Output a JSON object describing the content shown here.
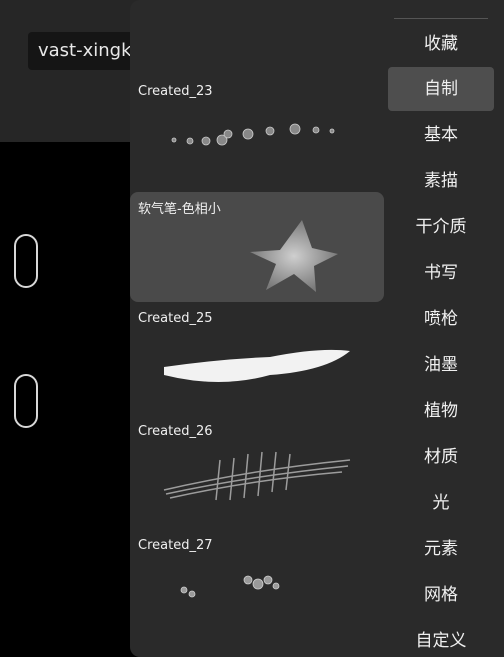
{
  "watermark": "vast-xingkong.com.cn",
  "brushes": [
    {
      "name": "Created_23"
    },
    {
      "name": "软气笔-色相小"
    },
    {
      "name": "Created_25"
    },
    {
      "name": "Created_26"
    },
    {
      "name": "Created_27"
    }
  ],
  "categories": [
    {
      "label": "收藏"
    },
    {
      "label": "自制",
      "active": true
    },
    {
      "label": "基本"
    },
    {
      "label": "素描"
    },
    {
      "label": "干介质"
    },
    {
      "label": "书写"
    },
    {
      "label": "喷枪"
    },
    {
      "label": "油墨"
    },
    {
      "label": "植物"
    },
    {
      "label": "材质"
    },
    {
      "label": "光"
    },
    {
      "label": "元素"
    },
    {
      "label": "网格"
    },
    {
      "label": "自定义"
    }
  ]
}
